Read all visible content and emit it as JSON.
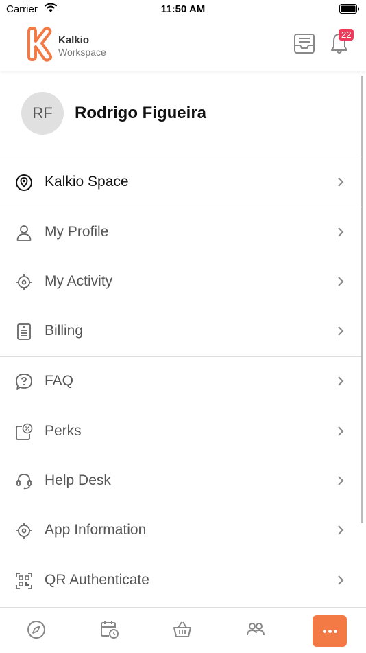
{
  "status_bar": {
    "carrier": "Carrier",
    "time": "11:50 AM"
  },
  "header": {
    "brand_name": "Kalkio",
    "brand_sub": "Workspace",
    "notification_count": "22",
    "brand_color": "#f47a45",
    "badge_color": "#ee3b5b"
  },
  "profile": {
    "initials": "RF",
    "name": "Rodrigo Figueira"
  },
  "menu": {
    "space": {
      "label": "Kalkio Space",
      "icon": "location-pin-icon"
    },
    "items": [
      {
        "label": "My Profile",
        "icon": "person-icon"
      },
      {
        "label": "My Activity",
        "icon": "target-icon"
      },
      {
        "label": "Billing",
        "icon": "receipt-icon"
      },
      {
        "label": "FAQ",
        "icon": "question-bubble-icon"
      },
      {
        "label": "Perks",
        "icon": "discount-tag-icon"
      },
      {
        "label": "Help Desk",
        "icon": "headset-icon"
      },
      {
        "label": "App Information",
        "icon": "target-icon"
      },
      {
        "label": "QR Authenticate",
        "icon": "qr-code-icon"
      }
    ]
  },
  "tab_bar": {
    "tabs": [
      "compass-icon",
      "calendar-clock-icon",
      "basket-icon",
      "people-icon",
      "more-icon"
    ],
    "active": "more-icon"
  }
}
